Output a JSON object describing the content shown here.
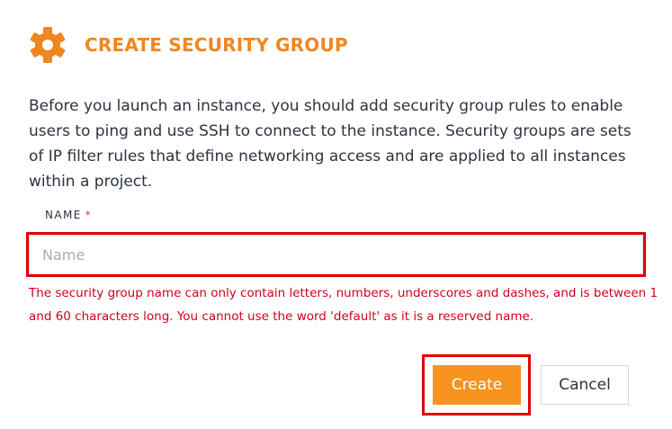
{
  "header": {
    "icon": "gear-icon",
    "title": "CREATE SECURITY GROUP",
    "accent_color": "#f0861f"
  },
  "description": "Before you launch an instance, you should add security group rules to enable users to ping and use SSH to connect to the instance. Security groups are sets of IP filter rules that define networking access and are applied to all instances within a project.",
  "form": {
    "name_label": "NAME",
    "required_marker": "*",
    "name_value": "",
    "name_placeholder": "Name",
    "error_message": "The security group name can only contain letters, numbers, underscores and dashes, and is between 1 and 60 characters long. You cannot use the word 'default' as it is a reserved name.",
    "error_color": "#d0021b"
  },
  "actions": {
    "create_label": "Create",
    "cancel_label": "Cancel",
    "create_color": "#f7931e"
  }
}
